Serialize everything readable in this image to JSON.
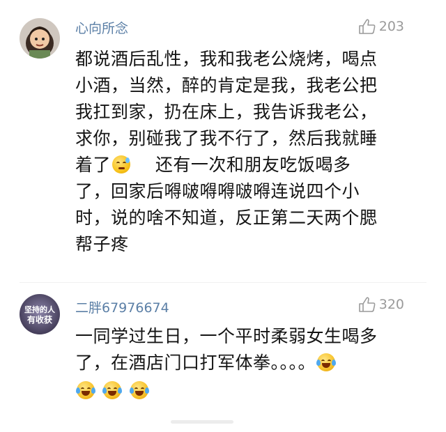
{
  "comments": [
    {
      "username": "心向所念",
      "likes": "203",
      "lines": [
        "都说酒后乱性，我和我老公烧烤，喝点",
        "小酒，当然，醉的肯定是我，我老公把",
        "我扛到家，扔在床上，我告诉我老公，",
        "求你，别碰我了我不行了，然后我就睡",
        "着了",
        "还有一次和朋友吃饭喝多",
        "了，回家后嘚啵嘚嘚啵嘚连说四个小",
        "时，说的啥不知道，反正第二天两个腮",
        "帮子疼"
      ]
    },
    {
      "username": "二胖67976674",
      "likes": "320",
      "avatar_text": [
        "坚持的人",
        "有收获"
      ],
      "lines": [
        "一同学过生日，一个平时柔弱女生喝多",
        "了，在酒店门口打军体拳。。。。"
      ]
    }
  ],
  "icons": {
    "like": "thumbs-up-icon",
    "emoji_sleepy": "sleepy-face-icon",
    "emoji_laugh": "laughing-crying-face-icon"
  },
  "colors": {
    "username": "#5b7fa6",
    "likes": "#9a9a9a",
    "text": "#141414"
  }
}
